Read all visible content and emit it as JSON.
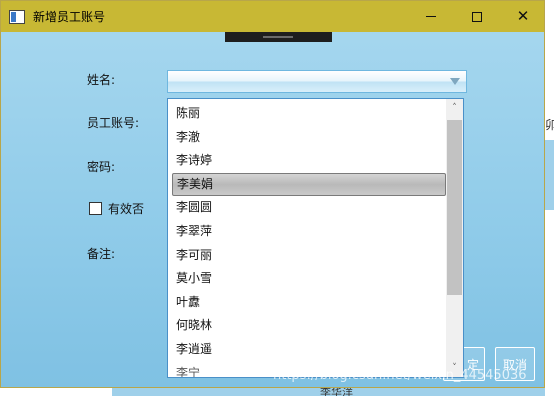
{
  "window": {
    "title": "新增员工账号",
    "controls": {
      "minimize": "—",
      "maximize": "☐",
      "close": "✕"
    }
  },
  "form": {
    "name_label": "姓名:",
    "account_label": "员工账号:",
    "password_label": "密码:",
    "valid_label": "有效否",
    "valid_checked": false,
    "remark_label": "备注:",
    "name_value": ""
  },
  "dropdown": {
    "items": [
      "陈丽",
      "李澈",
      "李诗婷",
      "李美娟",
      "李圆圆",
      "李翠萍",
      "李可丽",
      "莫小雪",
      "叶纛",
      "何晓林",
      "李逍遥",
      "李宁"
    ],
    "selected": "李美娟",
    "scroll_up": "˄",
    "scroll_down": "˅"
  },
  "buttons": {
    "ok": "定",
    "cancel": "取消"
  },
  "background": {
    "right_edge_char": "卯",
    "bottom_text": "李华洋"
  },
  "watermark": "https://blog.csdn.net/weixin_44545036",
  "colors": {
    "titlebar": "#c8b834",
    "window_bg": "#8fcbe9",
    "selection": "#c0c0c0",
    "dropdown_border": "#4a90c8"
  }
}
